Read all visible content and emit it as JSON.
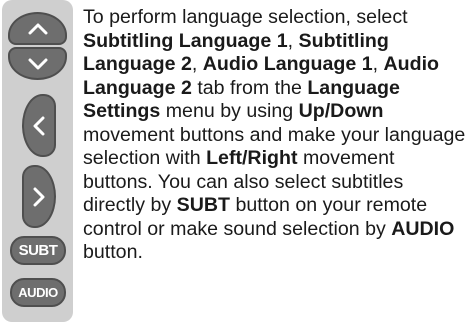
{
  "remote": {
    "subt_label": "SUBT",
    "audio_label": "AUDIO",
    "colors": {
      "strip": "#cfcfcf",
      "button": "#6e6e6e",
      "button_border": "#4f4f4f"
    },
    "icons": [
      "chevron-up-icon",
      "chevron-down-icon",
      "chevron-left-icon",
      "chevron-right-icon"
    ]
  },
  "instructions": {
    "t1": "To perform language selection, select ",
    "b1": "Subtitling Language 1",
    "t2": ", ",
    "b2": "Subtitling Language 2",
    "t3": ", ",
    "b3": "Audio Language 1",
    "t4": ", ",
    "b4": "Audio Language 2",
    "t5": " tab from the ",
    "b5": "Language Settings",
    "t6": " menu by using ",
    "b6": "Up/Down",
    "t7": " movement buttons and make your language selection with ",
    "b7": "Left/Right",
    "t8": " movement buttons. You can also select subtitles directly by ",
    "b8": "SUBT",
    "t9": " button on your remote control or make sound selection by ",
    "b9": "AUDIO",
    "t10": " button."
  }
}
